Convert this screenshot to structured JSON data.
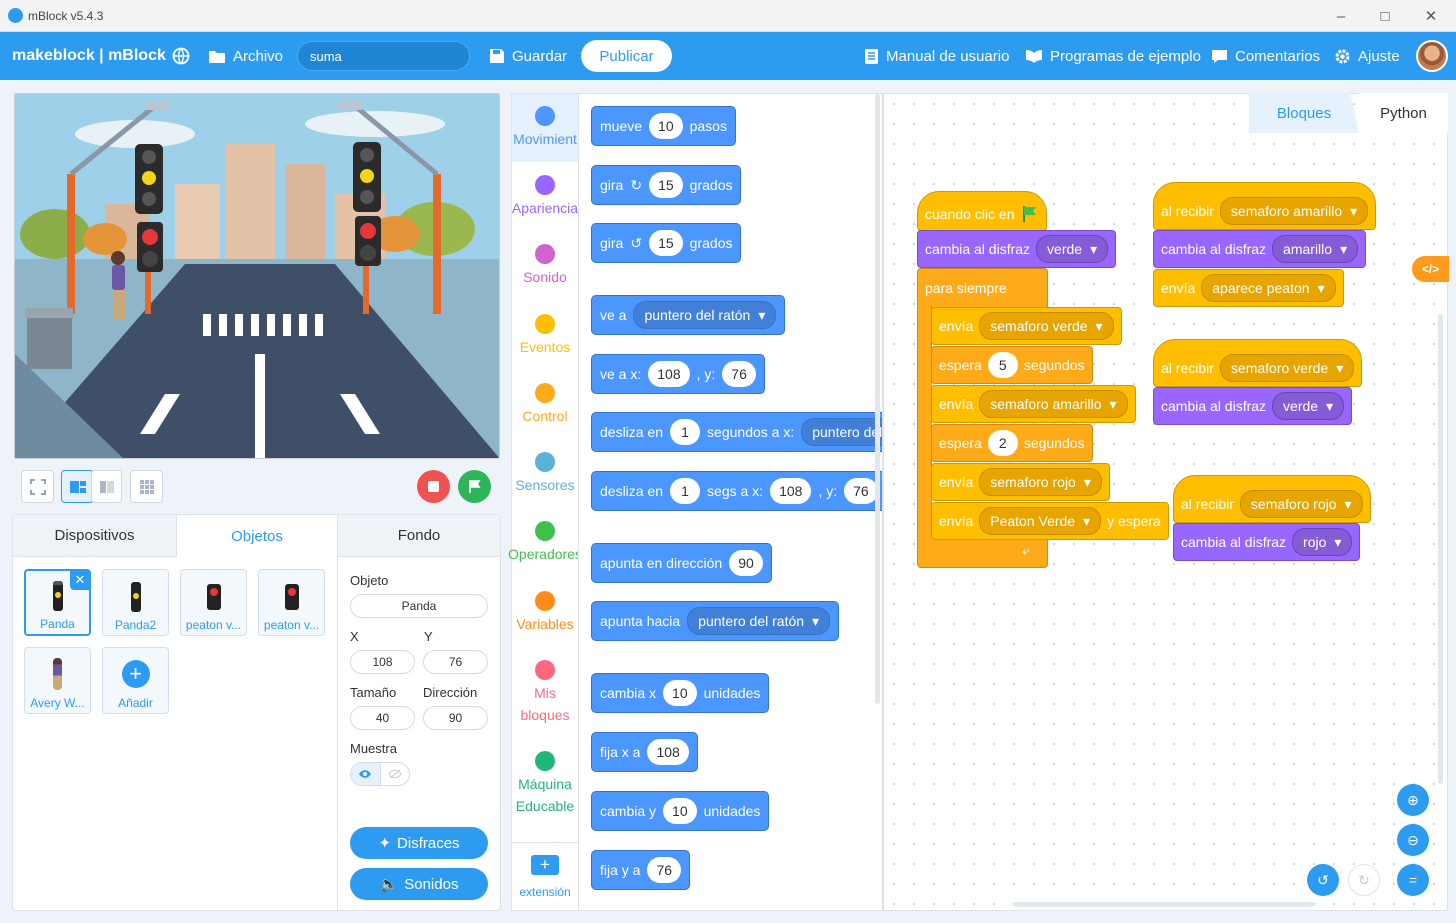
{
  "window": {
    "title": "mBlock v5.4.3"
  },
  "header": {
    "brand": "makeblock | mBlock",
    "file_label": "Archivo",
    "project_name": "suma",
    "save_label": "Guardar",
    "publish_label": "Publicar",
    "manual_label": "Manual de usuario",
    "examples_label": "Programas de ejemplo",
    "comments_label": "Comentarios",
    "settings_label": "Ajuste"
  },
  "sprite_panel": {
    "tabs": [
      "Dispositivos",
      "Objetos",
      "Fondo"
    ],
    "sprites": [
      {
        "name": "Panda"
      },
      {
        "name": "Panda2"
      },
      {
        "name": "peaton v..."
      },
      {
        "name": "peaton v..."
      },
      {
        "name": "Avery W..."
      }
    ],
    "add_label": "Añadir",
    "props": {
      "object_label": "Objeto",
      "object_value": "Panda",
      "x_label": "X",
      "x_value": "108",
      "y_label": "Y",
      "y_value": "76",
      "size_label": "Tamaño",
      "size_value": "40",
      "direction_label": "Dirección",
      "direction_value": "90",
      "show_label": "Muestra"
    },
    "costumes_label": "Disfraces",
    "sounds_label": "Sonidos"
  },
  "categories": [
    {
      "label": "Movimient",
      "color": "#4c97ff"
    },
    {
      "label": "Apariencia",
      "color": "#9966ff"
    },
    {
      "label": "Sonido",
      "color": "#cf63cf"
    },
    {
      "label": "Eventos",
      "color": "#ffbf00"
    },
    {
      "label": "Control",
      "color": "#ffab19"
    },
    {
      "label": "Sensores",
      "color": "#5cb1d6"
    },
    {
      "label": "Operadores",
      "color": "#40bf4a"
    },
    {
      "label": "Variables",
      "color": "#ff8c1a"
    },
    {
      "label": "Mis",
      "label2": "bloques",
      "color": "#ff6680"
    },
    {
      "label": "Máquina",
      "label2": "Educable",
      "color": "#21b67a"
    }
  ],
  "extension_label": "extensión",
  "palette": {
    "b1": [
      "mueve",
      "10",
      "pasos"
    ],
    "b2": [
      "gira",
      "15",
      "grados"
    ],
    "b3": [
      "gira",
      "15",
      "grados"
    ],
    "b4": [
      "ve a",
      "puntero del ratón"
    ],
    "b5": [
      "ve a x:",
      "108",
      ", y:",
      "76"
    ],
    "b6": [
      "desliza en",
      "1",
      "segundos a x:",
      "puntero del"
    ],
    "b7": [
      "desliza en",
      "1",
      "segs a x:",
      "108",
      ", y:",
      "76"
    ],
    "b8": [
      "apunta en dirección",
      "90"
    ],
    "b9": [
      "apunta hacia",
      "puntero del ratón"
    ],
    "b10": [
      "cambia x",
      "10",
      "unidades"
    ],
    "b11": [
      "fija x a",
      "108"
    ],
    "b12": [
      "cambia y",
      "10",
      "unidades"
    ],
    "b13": [
      "fija y a",
      "76"
    ]
  },
  "workspace": {
    "tabs": [
      "Bloques",
      "Python"
    ],
    "script1": {
      "hat": "cuando clic en",
      "costume_text": "cambia al disfraz",
      "costume": "verde",
      "loop": "para siempre",
      "s1": [
        "envía",
        "semaforo verde"
      ],
      "s2": [
        "espera",
        "5",
        "segundos"
      ],
      "s3": [
        "envía",
        "semaforo amarillo"
      ],
      "s4": [
        "espera",
        "2",
        "segundos"
      ],
      "s5": [
        "envía",
        "semaforo rojo"
      ],
      "s6": [
        "envía",
        "Peaton Verde",
        "y espera"
      ]
    },
    "script2": {
      "hat": "al recibir",
      "msg": "semaforo amarillo",
      "costume_text": "cambia al disfraz",
      "costume": "amarillo",
      "send": "envía",
      "send_msg": "aparece peaton"
    },
    "script3": {
      "hat": "al recibir",
      "msg": "semaforo verde",
      "costume_text": "cambia al disfraz",
      "costume": "verde"
    },
    "script4": {
      "hat": "al recibir",
      "msg": "semaforo rojo",
      "costume_text": "cambia al disfraz",
      "costume": "rojo"
    }
  }
}
